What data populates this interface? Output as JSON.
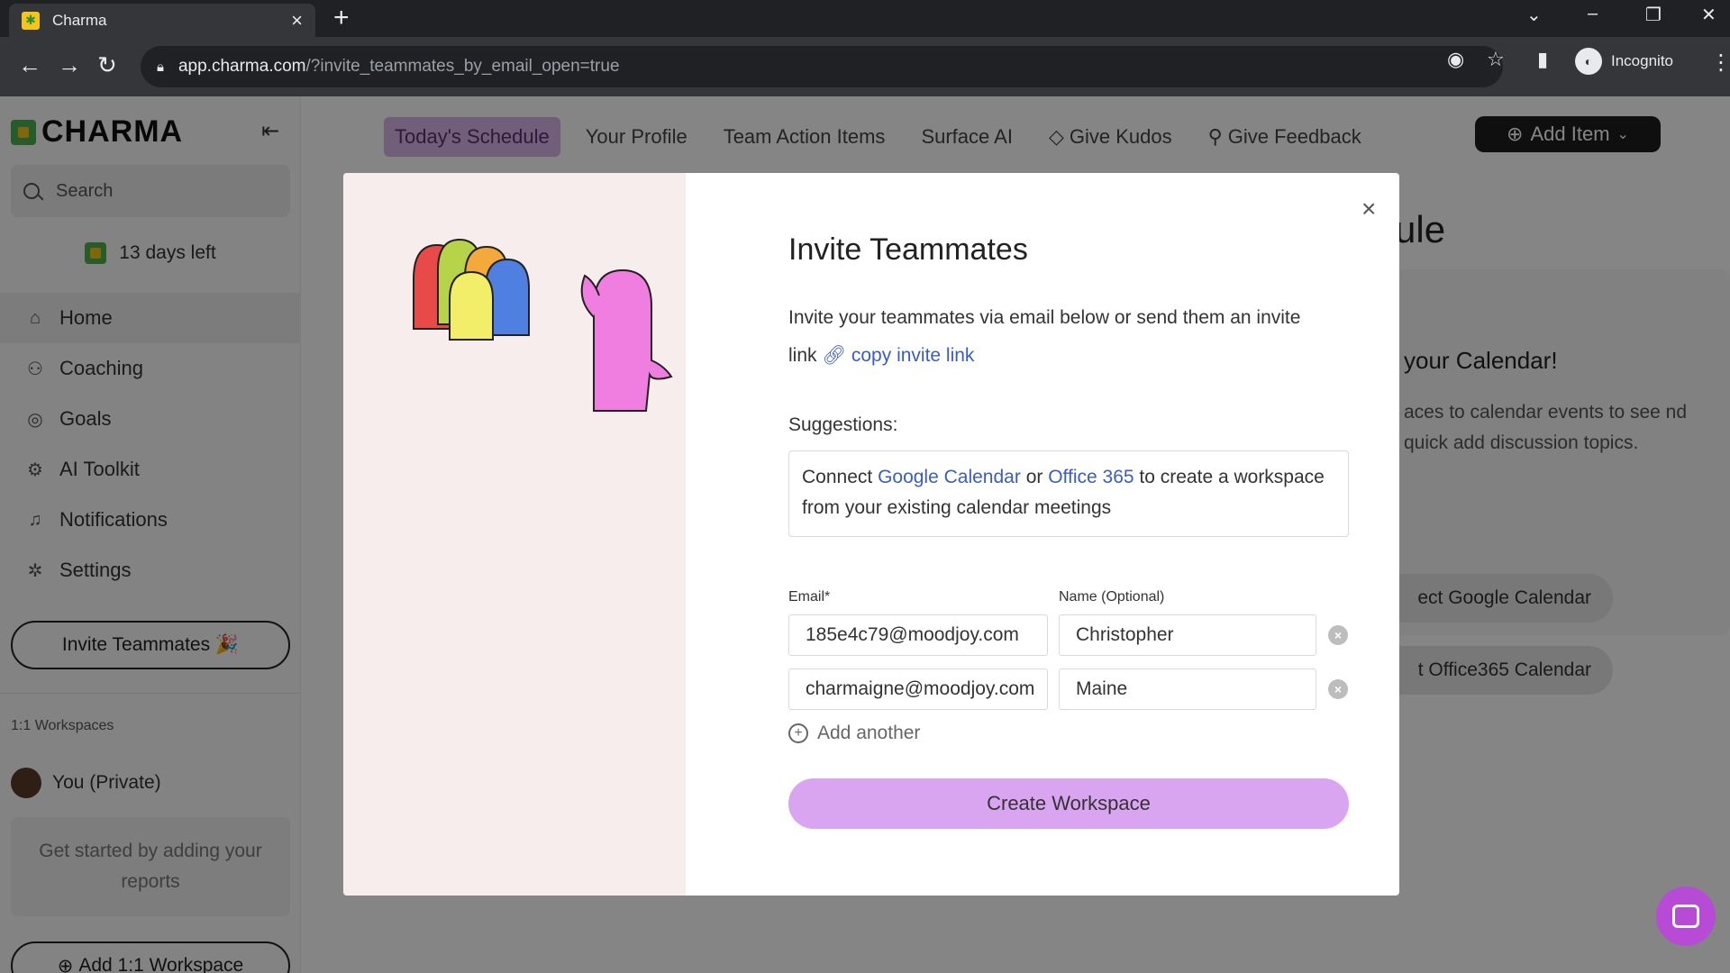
{
  "browser": {
    "tab_title": "Charma",
    "url_host": "app.charma.com",
    "url_path": "/?invite_teammates_by_email_open=true",
    "incognito_label": "Incognito"
  },
  "app": {
    "logo": "CHARMA",
    "search_placeholder": "Search",
    "trial_text": "13 days left",
    "nav": [
      {
        "label": "Home",
        "icon": "home-icon"
      },
      {
        "label": "Coaching",
        "icon": "coaching-icon"
      },
      {
        "label": "Goals",
        "icon": "goals-icon"
      },
      {
        "label": "AI Toolkit",
        "icon": "ai-toolkit-icon"
      },
      {
        "label": "Notifications",
        "icon": "bell-icon"
      },
      {
        "label": "Settings",
        "icon": "gear-icon"
      }
    ],
    "invite_button": "Invite Teammates 🎉",
    "workspaces_label": "1:1 Workspaces",
    "private_workspace": "You (Private)",
    "reports_hint": "Get started by adding your reports",
    "add_workspace": "Add 1:1 Workspace",
    "top_nav": [
      "Today's Schedule",
      "Your Profile",
      "Team Action Items",
      "Surface AI",
      "Give Kudos",
      "Give Feedback"
    ],
    "add_item": "Add Item",
    "bg_title_fragment": "ule",
    "bg_card": {
      "heading_fragment": "your Calendar!",
      "text_fragment": "aces to calendar events to see nd quick add discussion topics.",
      "google_btn_fragment": "ect Google Calendar",
      "office_btn_fragment": "t Office365 Calendar"
    }
  },
  "modal": {
    "title": "Invite Teammates",
    "description": "Invite your teammates via email below or send them an invite link",
    "copy_link": "copy invite link",
    "suggestions_label": "Suggestions:",
    "suggestion": {
      "prefix": "Connect",
      "google": "Google Calendar",
      "or": "or",
      "office": "Office 365",
      "suffix": "to create a workspace from your existing calendar meetings"
    },
    "email_label": "Email*",
    "name_label": "Name (Optional)",
    "rows": [
      {
        "email": "185e4c79@moodjoy.com",
        "name": "Christopher"
      },
      {
        "email": "charmaigne@moodjoy.com",
        "name": "Maine"
      }
    ],
    "add_another": "Add another",
    "create_button": "Create Workspace"
  }
}
